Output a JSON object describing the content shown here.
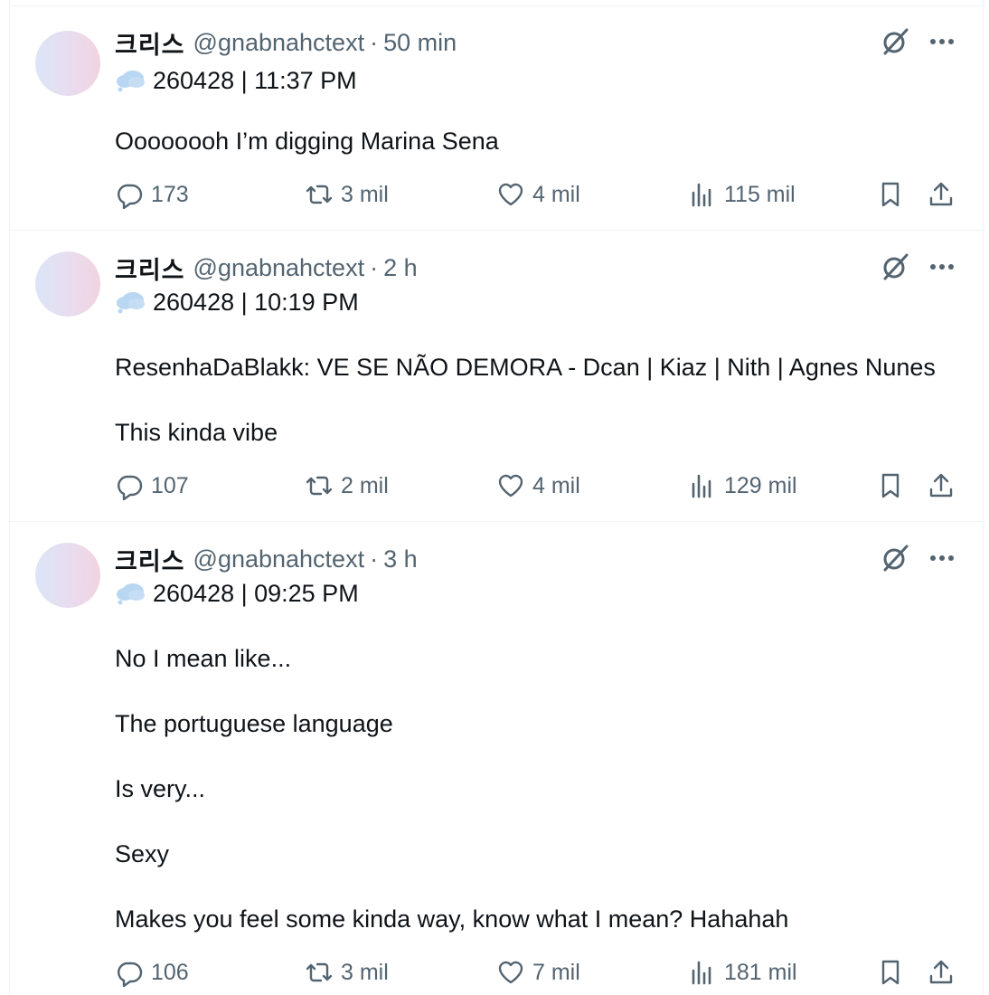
{
  "posts": [
    {
      "display_name": "크리스",
      "handle": "@gnabnahctext",
      "separator": "·",
      "time": "50 min",
      "subline_icon": "cloud-icon",
      "subline": "260428 | 11:37 PM",
      "body": [
        "Oooooooh I’m digging Marina Sena"
      ],
      "replies": "173",
      "reposts": "3 mil",
      "likes": "4 mil",
      "views": "115 mil"
    },
    {
      "display_name": "크리스",
      "handle": "@gnabnahctext",
      "separator": "·",
      "time": "2 h",
      "subline_icon": "cloud-icon",
      "subline": "260428 | 10:19 PM",
      "body": [
        "ResenhaDaBlakk: VE SE NÃO DEMORA - Dcan | Kiaz | Nith | Agnes Nunes",
        "This kinda vibe"
      ],
      "replies": "107",
      "reposts": "2 mil",
      "likes": "4 mil",
      "views": "129 mil"
    },
    {
      "display_name": "크리스",
      "handle": "@gnabnahctext",
      "separator": "·",
      "time": "3 h",
      "subline_icon": "cloud-icon",
      "subline": "260428 | 09:25 PM",
      "body": [
        "No I mean like...",
        "The portuguese language",
        "Is very...",
        "Sexy",
        "Makes you feel some kinda way, know what I mean? Hahahah"
      ],
      "replies": "106",
      "reposts": "3 mil",
      "likes": "7 mil",
      "views": "181 mil"
    }
  ],
  "colors": {
    "text": "#0f1419",
    "secondary": "#536471",
    "divider": "#eff3f4",
    "cloud": "#b9d7f2"
  }
}
